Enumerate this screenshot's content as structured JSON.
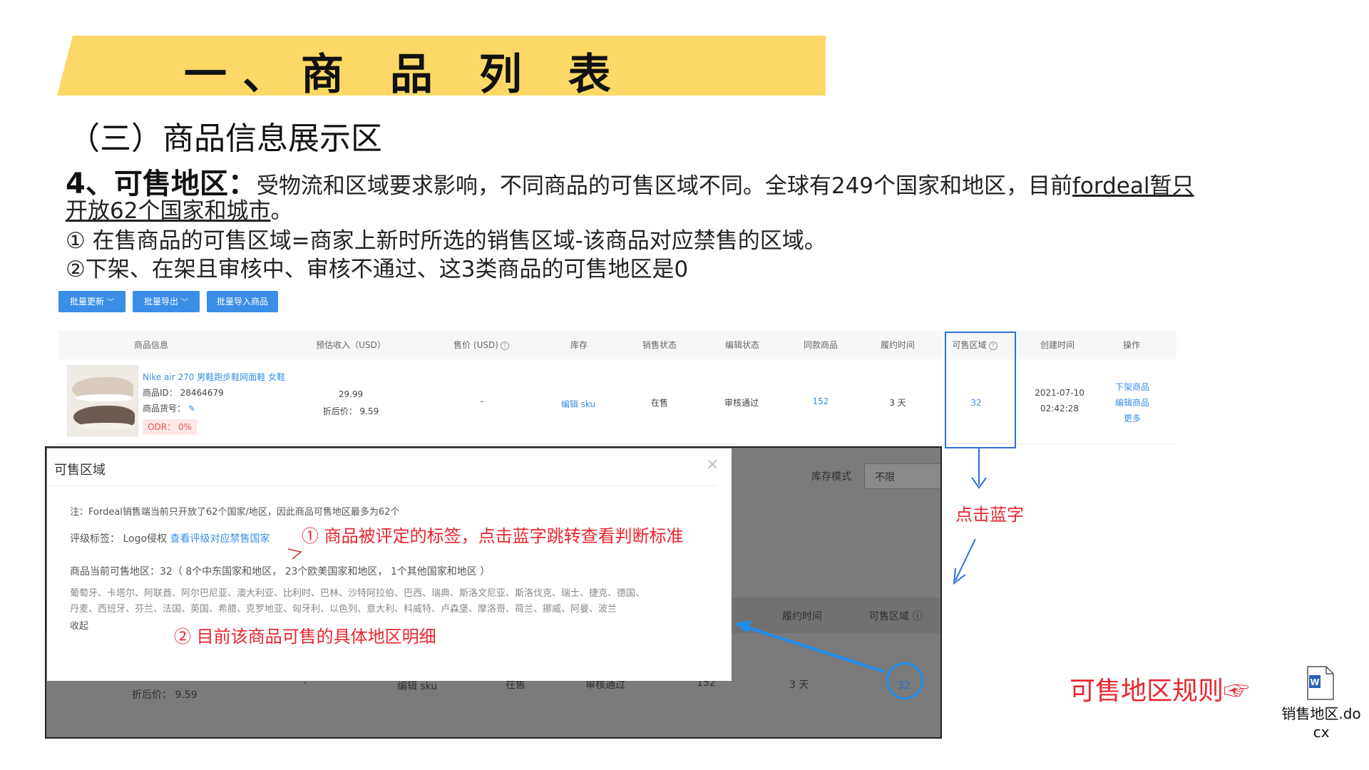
{
  "header": {
    "title": "一、商 品 列 表"
  },
  "subtitle": "（三）商品信息展示区",
  "body": {
    "line1_heading": "4、可售地区：",
    "line1_text": "受物流和区域要求影响，不同商品的可售区域不同。全球有249个国家和地区，目前",
    "line1_underlined": "fordeal暂只",
    "line2_underlined": "开放62个国家和城市",
    "line2_end": "。",
    "line3": "① 在售商品的可售区域=商家上新时所选的销售区域-该商品对应禁售的区域。",
    "line4": "②下架、在架且审核中、审核不通过、这3类商品的可售地区是0"
  },
  "toolbar": {
    "batch_update": "批量更新",
    "batch_export": "批量导出",
    "batch_import": "批量导入商品"
  },
  "table": {
    "headers": [
      "商品信息",
      "预估收入（USD）",
      "售价 (USD)",
      "库存",
      "销售状态",
      "编辑状态",
      "同款商品",
      "履约时间",
      "可售区域",
      "创建时间",
      "操作"
    ],
    "row": {
      "product_name": "Nike air 270 男鞋跑步鞋网面鞋 女鞋",
      "product_id": "商品ID： 28464679",
      "product_sku_label": "商品货号：",
      "odr": "ODR： 0%",
      "income": "29.99",
      "discount": "折后价： 9.59",
      "price": "-",
      "stock": "编辑 sku",
      "sale_status": "在售",
      "edit_status": "审核通过",
      "same_items": "152",
      "fulfill": "3 天",
      "region": "32",
      "created_date": "2021-07-10",
      "created_time": "02:42:28",
      "ops": [
        "下架商品",
        "编辑商品",
        "更多"
      ]
    }
  },
  "dark_shot": {
    "stock_mode_label": "库存模式",
    "stock_mode_value": "不限",
    "fulfill_header": "履约时间",
    "region_header": "可售区域",
    "discount": "折后价： 9.59",
    "price": "-",
    "stock": "编辑 sku",
    "sale_status": "在售",
    "edit_status": "审核通过",
    "same_items": "152",
    "fulfill": "3 天",
    "region": "32"
  },
  "modal": {
    "title": "可售区域",
    "close": "×",
    "note": "注：Fordeal销售端当前只开放了62个国家/地区，因此商品可售地区最多为62个",
    "rating_label": "评级标签：  Logo侵权",
    "rating_link": "查看评级对应禁售国家",
    "current_regions": "商品当前可售地区：32（ 8个中东国家和地区， 23个欧美国家和地区， 1个其他国家和地区 ）",
    "countries_line1": "葡萄牙、卡塔尔、阿联酋、阿尔巴尼亚、澳大利亚、比利时、巴林、沙特阿拉伯、巴西、瑞典、斯洛文尼亚、斯洛伐克、瑞士、捷克、德国、",
    "countries_line2": "丹麦、西班牙、芬兰、法国、英国、希腊、克罗地亚、匈牙利、以色列、意大利、科威特、卢森堡、摩洛哥、荷兰、挪威、阿曼、波兰",
    "collapse": "收起"
  },
  "annotations": {
    "anno1": "① 商品被评定的标签，点击蓝字跳转查看判断标准",
    "anno2": "② 目前该商品可售的具体地区明细",
    "click_blue": "点击蓝字",
    "rules": "可售地区规则☞"
  },
  "attachment": {
    "filename_line1": "销售地区.do",
    "filename_line2": "cx"
  },
  "colors": {
    "banner": "#fdd866",
    "accent_blue": "#3a8ee6",
    "annotation_red": "#e8262f",
    "highlight_blue": "#2f6fd6"
  }
}
